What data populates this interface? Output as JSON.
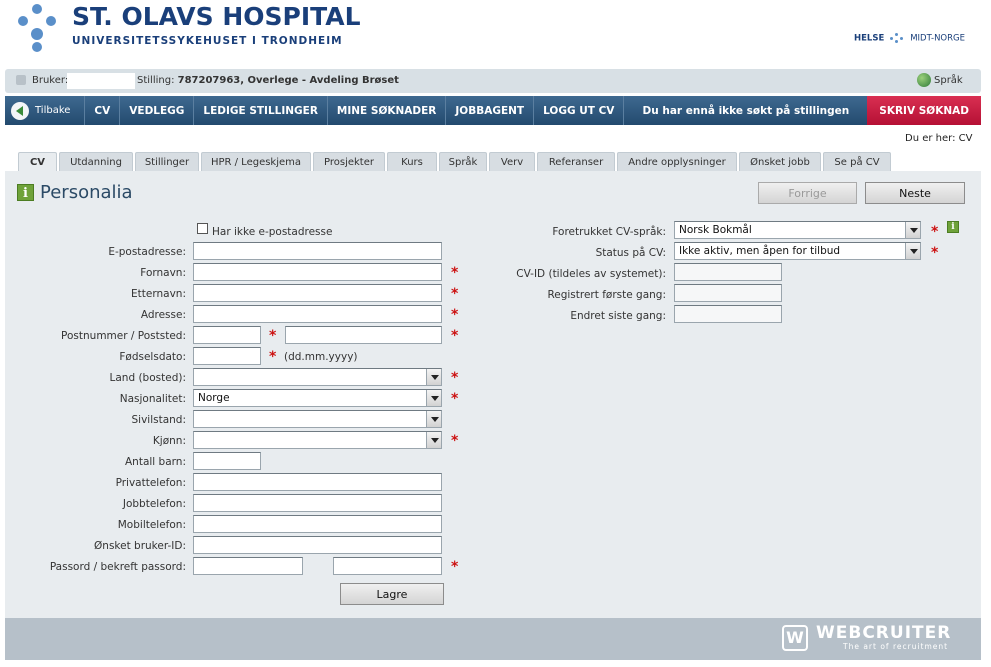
{
  "header": {
    "title": "ST. OLAVS HOSPITAL",
    "subtitle": "UNIVERSITETSSYKEHUSET I TRONDHEIM",
    "partner_left": "HELSE",
    "partner_right": "MIDT-NORGE"
  },
  "userbar": {
    "user_label": "Bruker:",
    "position_label": "Stilling:",
    "position_value": "787207963, Overlege - Avdeling Brøset",
    "language": "Språk"
  },
  "nav": {
    "back": "Tilbake",
    "items": [
      "CV",
      "VEDLEGG",
      "LEDIGE STILLINGER",
      "MINE SØKNADER",
      "JOBBAGENT",
      "LOGG UT CV"
    ],
    "status": "Du har ennå ikke søkt på stillingen",
    "apply": "SKRIV SØKNAD"
  },
  "breadcrumb": "Du er her: CV",
  "tabs": [
    "CV",
    "Utdanning",
    "Stillinger",
    "HPR / Legeskjema",
    "Prosjekter",
    "Kurs",
    "Språk",
    "Verv",
    "Referanser",
    "Andre opplysninger",
    "Ønsket jobb",
    "Se på CV"
  ],
  "page_title": "Personalia",
  "buttons": {
    "prev": "Forrige",
    "next": "Neste",
    "save": "Lagre"
  },
  "form_left": {
    "no_email": "Har ikke e-postadresse",
    "email": "E-postadresse:",
    "first_name": "Fornavn:",
    "last_name": "Etternavn:",
    "address": "Adresse:",
    "postal": "Postnummer / Poststed:",
    "birth": "Fødselsdato:",
    "birth_hint": "(dd.mm.yyyy)",
    "country": "Land (bosted):",
    "nationality": "Nasjonalitet:",
    "nationality_value": "Norge",
    "civil": "Sivilstand:",
    "gender": "Kjønn:",
    "children": "Antall barn:",
    "private_phone": "Privattelefon:",
    "work_phone": "Jobbtelefon:",
    "mobile": "Mobiltelefon:",
    "user_id": "Ønsket bruker-ID:",
    "password": "Passord / bekreft passord:"
  },
  "form_right": {
    "cv_lang": "Foretrukket CV-språk:",
    "cv_lang_value": "Norsk Bokmål",
    "cv_status": "Status på CV:",
    "cv_status_value": "Ikke aktiv, men åpen for tilbud",
    "cv_id": "CV-ID (tildeles av systemet):",
    "registered": "Registrert første gang:",
    "changed": "Endret siste gang:"
  },
  "footer": {
    "brand": "WEBCRUITER",
    "tagline": "The art of recruitment"
  },
  "colors": {
    "nav_bg": "#2d5479",
    "apply_bg": "#c81d43",
    "required": "#cc1111",
    "panel_bg": "#e8ecef"
  }
}
